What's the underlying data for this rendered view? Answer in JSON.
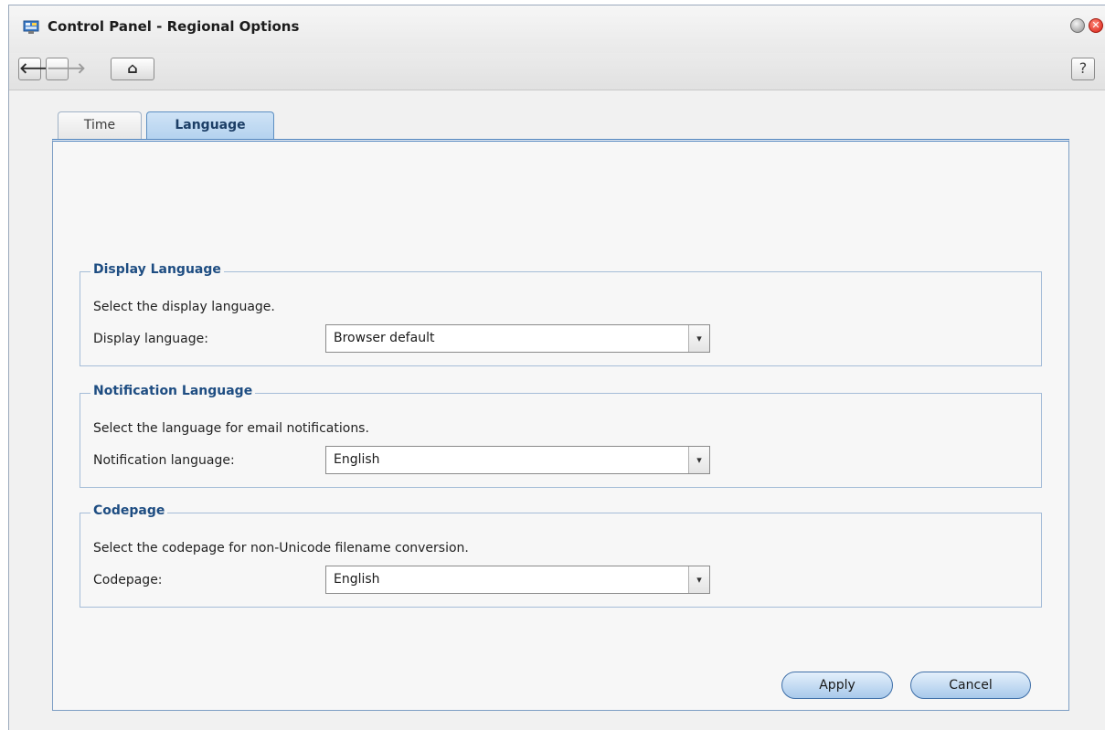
{
  "window": {
    "title": "Control Panel - Regional Options",
    "close_glyph": "✕",
    "app_icon": "control-panel-icon"
  },
  "toolbar": {
    "back_glyph": "🡐",
    "forward_glyph": "🡒",
    "home_glyph": "⌂",
    "help_label": "?"
  },
  "tabs": [
    {
      "label": "Time",
      "active": false
    },
    {
      "label": "Language",
      "active": true
    }
  ],
  "groups": {
    "display": {
      "title": "Display Language",
      "description": "Select the display language.",
      "field_label": "Display language:",
      "value": "Browser default"
    },
    "notification": {
      "title": "Notification Language",
      "description": "Select the language for email notifications.",
      "field_label": "Notification language:",
      "value": "English"
    },
    "codepage": {
      "title": "Codepage",
      "description": "Select the codepage for non-Unicode filename conversion.",
      "field_label": "Codepage:",
      "value": "English"
    }
  },
  "select_arrow": "▾",
  "buttons": {
    "apply": "Apply",
    "cancel": "Cancel"
  },
  "colors": {
    "group_title": "#1e4d82",
    "active_tab": "#b4d2ef",
    "button": "#a8c9eb",
    "close": "#d81d12"
  }
}
